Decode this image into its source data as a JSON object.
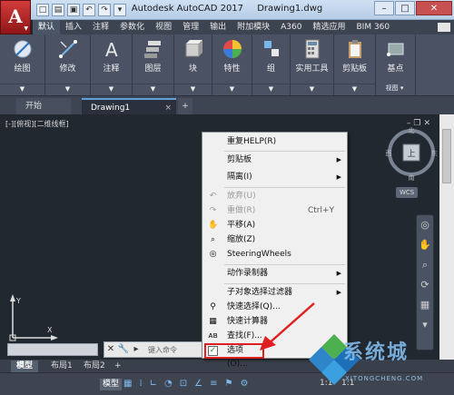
{
  "titlebar": {
    "app_name": "Autodesk AutoCAD 2017",
    "file_name": "Drawing1.dwg",
    "app_letter": "A"
  },
  "ribbon_tabs": [
    "默认",
    "插入",
    "注释",
    "参数化",
    "视图",
    "管理",
    "输出",
    "附加模块",
    "A360",
    "精选应用",
    "BIM 360"
  ],
  "ribbon_panels": [
    {
      "label": "绘图",
      "icon": "draw-icon"
    },
    {
      "label": "修改",
      "icon": "modify-icon"
    },
    {
      "label": "注释",
      "icon": "annotation-icon"
    },
    {
      "label": "图层",
      "icon": "layers-icon"
    },
    {
      "label": "块",
      "icon": "block-icon"
    },
    {
      "label": "特性",
      "icon": "properties-icon"
    },
    {
      "label": "组",
      "icon": "group-icon"
    },
    {
      "label": "实用工具",
      "icon": "utilities-icon"
    },
    {
      "label": "剪贴板",
      "icon": "clipboard-icon"
    },
    {
      "label": "基点",
      "icon": "basepoint-icon"
    },
    {
      "label": "视图",
      "icon": "view-icon"
    }
  ],
  "file_tabs": {
    "start": "开始",
    "drawing": "Drawing1",
    "add": "+"
  },
  "viewport": {
    "label": "[-][俯视][二维线框]",
    "viewcube_top": "上",
    "north": "北",
    "south": "南",
    "east": "东",
    "west": "西",
    "wcs": "WCS"
  },
  "ucs": {
    "x": "X",
    "y": "Y"
  },
  "context_menu": {
    "items": [
      {
        "label": "重复HELP(R)",
        "shortcut": "",
        "arrow": false,
        "disabled": false,
        "icon": ""
      },
      {
        "label": "剪贴板",
        "shortcut": "",
        "arrow": true,
        "disabled": false,
        "icon": ""
      },
      {
        "label": "隔离(I)",
        "shortcut": "",
        "arrow": true,
        "disabled": false,
        "icon": ""
      },
      {
        "label": "放弃(U)",
        "shortcut": "",
        "arrow": false,
        "disabled": true,
        "icon": "undo-icon"
      },
      {
        "label": "重做(R)",
        "shortcut": "Ctrl+Y",
        "arrow": false,
        "disabled": true,
        "icon": "redo-icon"
      },
      {
        "label": "平移(A)",
        "shortcut": "",
        "arrow": false,
        "disabled": false,
        "icon": "pan-icon"
      },
      {
        "label": "缩放(Z)",
        "shortcut": "",
        "arrow": false,
        "disabled": false,
        "icon": "zoom-icon"
      },
      {
        "label": "SteeringWheels",
        "shortcut": "",
        "arrow": false,
        "disabled": false,
        "icon": "steeringwheels-icon"
      },
      {
        "label": "动作录制器",
        "shortcut": "",
        "arrow": true,
        "disabled": false,
        "icon": ""
      },
      {
        "label": "子对象选择过滤器",
        "shortcut": "",
        "arrow": true,
        "disabled": false,
        "icon": ""
      },
      {
        "label": "快速选择(Q)...",
        "shortcut": "",
        "arrow": false,
        "disabled": false,
        "icon": "quick-select-icon"
      },
      {
        "label": "快速计算器",
        "shortcut": "",
        "arrow": false,
        "disabled": false,
        "icon": "calculator-icon"
      },
      {
        "label": "查找(F)...",
        "shortcut": "",
        "arrow": false,
        "disabled": false,
        "icon": "find-icon"
      },
      {
        "label": "选项(O)...",
        "shortcut": "",
        "arrow": false,
        "disabled": false,
        "icon": "options-checkbox-icon"
      }
    ]
  },
  "command_line": {
    "placeholder": "键入命令"
  },
  "layout_tabs": [
    "模型",
    "布局1",
    "布局2",
    "+"
  ],
  "status_bar": {
    "model_label": "模型",
    "scale": "1:1",
    "scale2": "1:1"
  },
  "watermark": {
    "text": "系统城",
    "sub": "XITONGCHENG.COM"
  },
  "colors": {
    "canvas_bg": "#212830",
    "ribbon_bg": "#4a5264",
    "annotation_red": "#e02020",
    "app_button_red": "#c02a2a"
  }
}
